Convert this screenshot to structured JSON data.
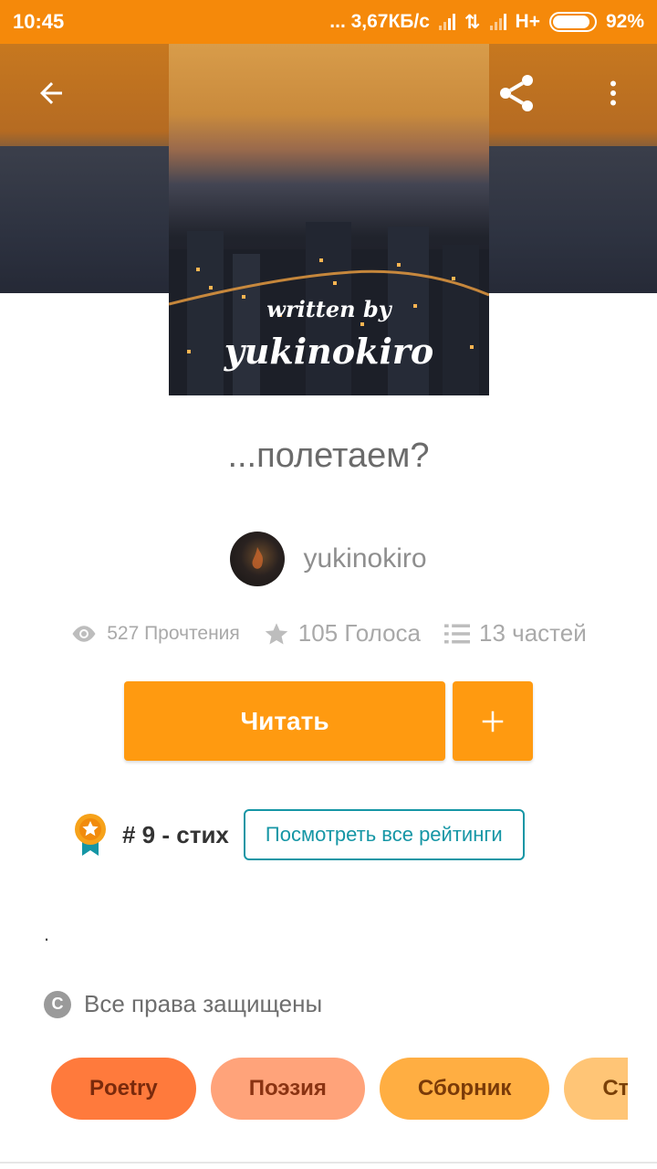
{
  "status_bar": {
    "time": "10:45",
    "network": "... 3,67КБ/с",
    "network_type": "H+",
    "battery": "92%",
    "battery_level": 0.92
  },
  "toolbar": {
    "back_icon": "arrow-left-icon",
    "share_icon": "share-icon",
    "menu_icon": "more-vertical-icon"
  },
  "cover": {
    "line1": "written by",
    "line2": "yukinokiro"
  },
  "story": {
    "title": "...полетаем?",
    "author": "yukinokiro"
  },
  "stats": {
    "reads": "527 Прочтения",
    "votes": "105 Голоса",
    "parts": "13 частей"
  },
  "actions": {
    "read_label": "Читать",
    "add_label": "+"
  },
  "ranking": {
    "text": "# 9 - стих",
    "button_label": "Посмотреть все рейтинги"
  },
  "description": ".",
  "rights": "Все права защищены",
  "tags": [
    "Poetry",
    "Поэзия",
    "Сборник",
    "Стихи"
  ],
  "colors": {
    "accent": "#ff9a10",
    "status_bar": "#f5890a",
    "link": "#1596a5"
  }
}
